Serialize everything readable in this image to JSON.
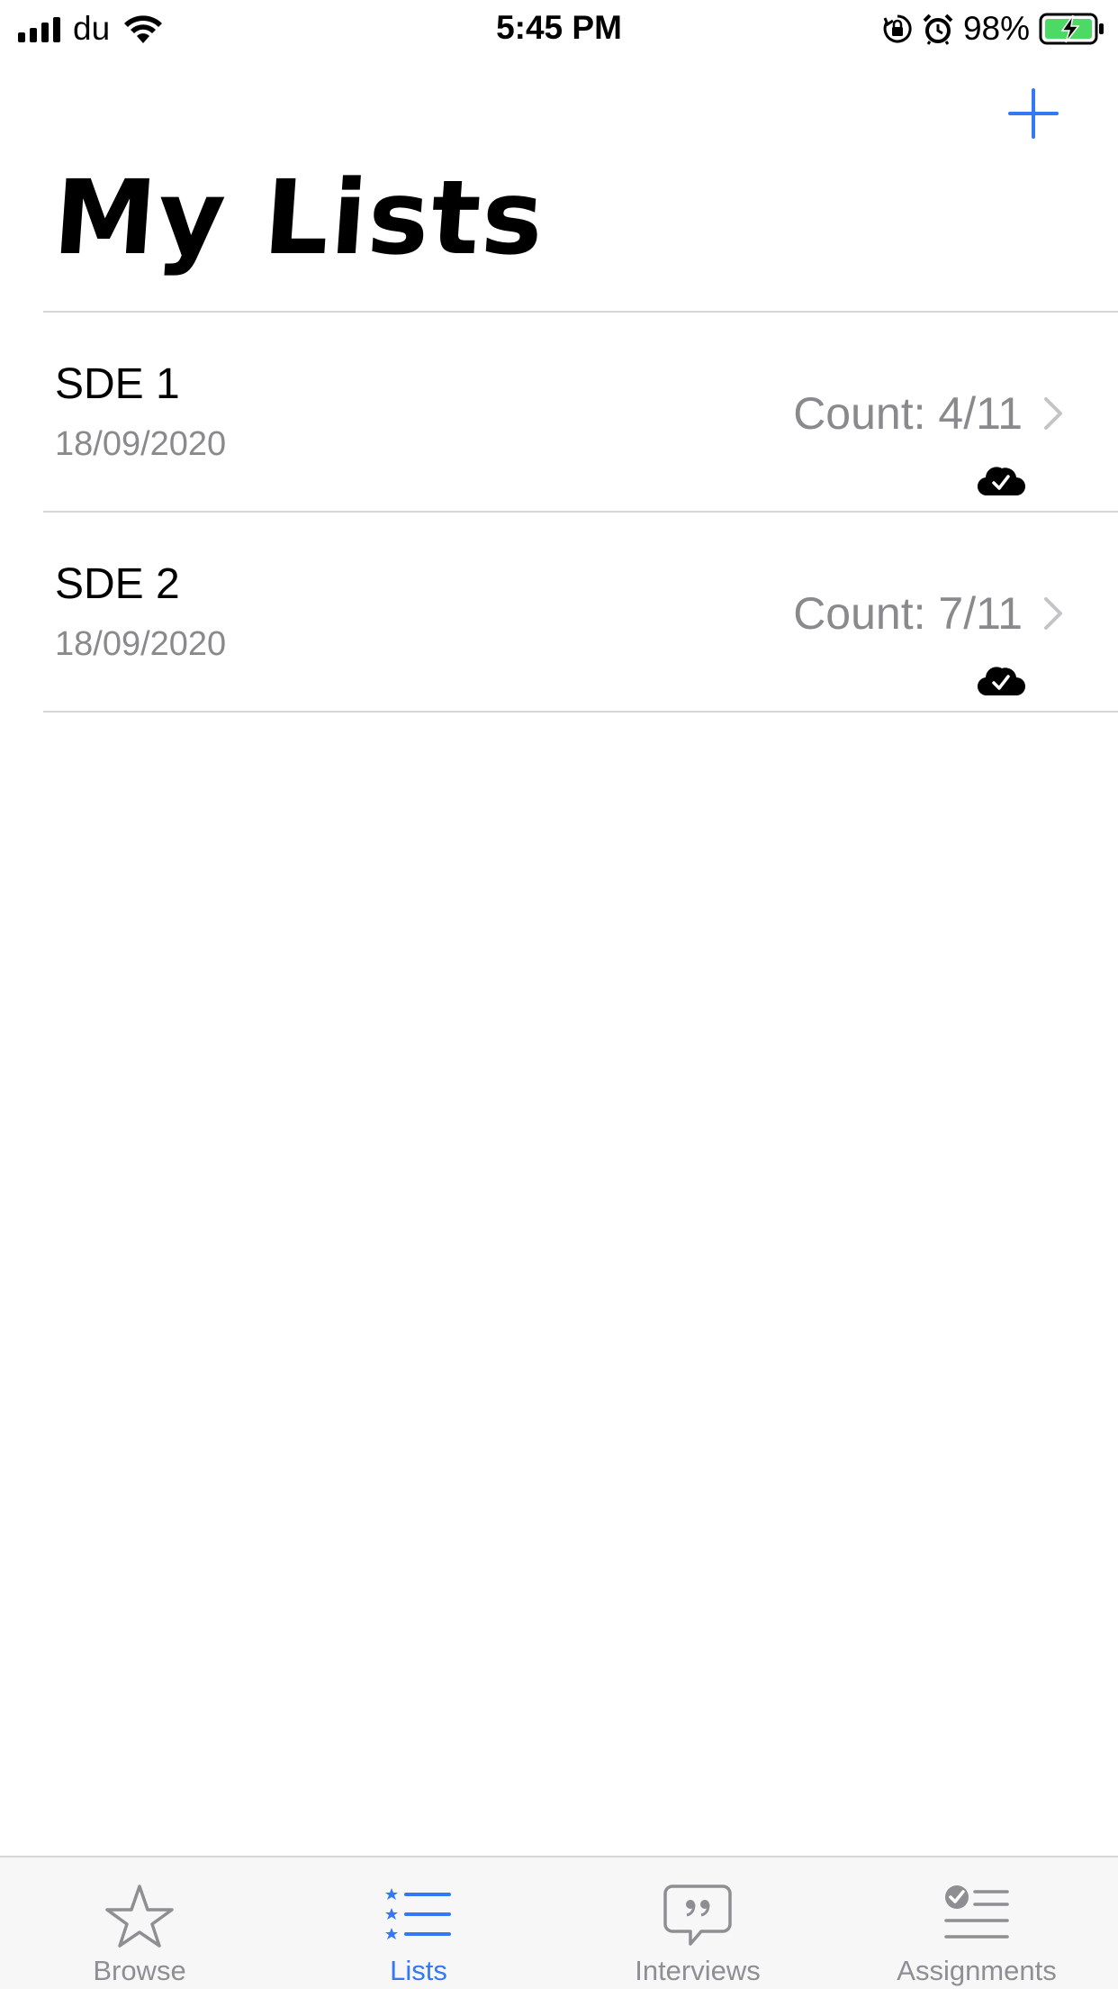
{
  "status_bar": {
    "carrier": "du",
    "time": "5:45 PM",
    "battery": "98%",
    "icons": [
      "signal-icon",
      "wifi-icon",
      "orientation-lock-icon",
      "alarm-icon",
      "battery-charging-icon"
    ]
  },
  "nav": {
    "add_icon": "plus-icon",
    "title": "My Lists"
  },
  "lists": [
    {
      "name": "SDE 1",
      "date": "18/09/2020",
      "count": "Count: 4/11",
      "sync_icon": "cloud-check-icon"
    },
    {
      "name": "SDE 2",
      "date": "18/09/2020",
      "count": "Count: 7/11",
      "sync_icon": "cloud-check-icon"
    }
  ],
  "tabs": [
    {
      "label": "Browse",
      "icon": "star-icon",
      "active": false
    },
    {
      "label": "Lists",
      "icon": "list-icon",
      "active": true
    },
    {
      "label": "Interviews",
      "icon": "quote-bubble-icon",
      "active": false
    },
    {
      "label": "Assignments",
      "icon": "checklist-icon",
      "active": false
    }
  ],
  "colors": {
    "accent": "#3478f6",
    "secondary_text": "#8a8a8e",
    "divider": "#d6d6d6",
    "tab_inactive": "#8e8e93",
    "battery_fill": "#4cd964"
  }
}
